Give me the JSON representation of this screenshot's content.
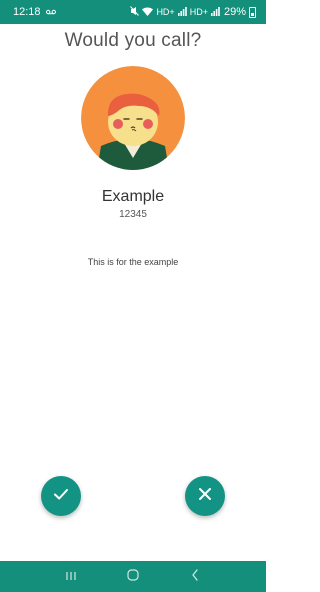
{
  "status_bar": {
    "time": "12:18",
    "battery_percent": "29%",
    "network_1": "HD+",
    "network_2": "HD+",
    "icons": [
      "voicemail-icon",
      "mute-icon",
      "wifi-icon",
      "signal-icon",
      "battery-icon"
    ]
  },
  "screen": {
    "title": "Would you call?"
  },
  "contact": {
    "avatar": "cartoon-avatar",
    "name": "Example",
    "number": "12345",
    "description": "This is for the example"
  },
  "actions": {
    "accept": "check-icon",
    "decline": "close-icon"
  },
  "nav_bar": {
    "buttons": [
      "recent-apps-icon",
      "home-icon",
      "back-icon"
    ]
  },
  "colors": {
    "accent": "#139383",
    "bar": "#138f7b",
    "avatar_bg": "#f5913e"
  }
}
